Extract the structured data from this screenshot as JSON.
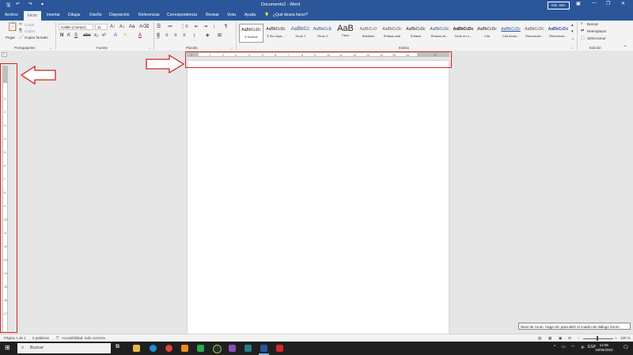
{
  "titlebar": {
    "title": "Documento2  -  Word",
    "signin": "Inic. ses.",
    "autosave_icon": "save-icon",
    "undo_icon": "undo-icon",
    "redo_icon": "redo-icon"
  },
  "tabs": [
    "Archivo",
    "Inicio",
    "Insertar",
    "Dibujar",
    "Diseño",
    "Disposición",
    "Referencias",
    "Correspondencia",
    "Revisar",
    "Vista",
    "Ayuda"
  ],
  "tell_me": "¿Qué desea hacer?",
  "ribbon": {
    "clipboard": {
      "paste": "Pegar",
      "cut": "Cortar",
      "copy": "Copiar",
      "format_painter": "Copiar formato",
      "label": "Portapapeles"
    },
    "font": {
      "name": "Calibri (Cuerpo)",
      "size": "11",
      "label": "Fuente"
    },
    "paragraph": {
      "label": "Párrafo"
    },
    "styles": {
      "label": "Estilos",
      "items": [
        {
          "sample": "AaBbCcDc",
          "name": "¶ Normal"
        },
        {
          "sample": "AaBbCcDc",
          "name": "¶ Sin espa..."
        },
        {
          "sample": "AaBbCc",
          "name": "Título 1"
        },
        {
          "sample": "AaBbCcE",
          "name": "Título 2"
        },
        {
          "sample": "AaB",
          "name": "Título"
        },
        {
          "sample": "AaBbCcD",
          "name": "Subtítulo"
        },
        {
          "sample": "AaBbCcDc",
          "name": "Énfasis sutil"
        },
        {
          "sample": "AaBbCcDc",
          "name": "Énfasis"
        },
        {
          "sample": "AaBbCcDc",
          "name": "Énfasis int..."
        },
        {
          "sample": "AaBbCcDc",
          "name": "Texto en n..."
        },
        {
          "sample": "AaBbCcDc",
          "name": "Cita"
        },
        {
          "sample": "AaBbCcDc",
          "name": "Cita desta..."
        },
        {
          "sample": "AaBbCcDc",
          "name": "Referencia..."
        },
        {
          "sample": "AaBbCcDc",
          "name": "Referencia..."
        }
      ]
    },
    "editing": {
      "find": "Buscar",
      "replace": "Reemplazar",
      "select": "Seleccionar",
      "label": "Edición"
    }
  },
  "ruler_ticks": [
    "1",
    "2",
    "3",
    "4",
    "5",
    "6",
    "7",
    "8",
    "9",
    "10",
    "11",
    "12",
    "13",
    "14",
    "15",
    "16",
    "17"
  ],
  "status": {
    "page": "Página 1 de 1",
    "words": "0 palabras",
    "accessibility": "Accesibilidad: todo correcto",
    "zoom": "100 %"
  },
  "tooltip": "Nivel de zoom. Haga clic para abrir el cuadro de diálogo Zoom.",
  "taskbar": {
    "search": "Buscar",
    "time": "12:06",
    "date": "15/05/2023"
  },
  "colors": {
    "word_blue": "#2b579a",
    "annotation_red": "#d22222"
  }
}
